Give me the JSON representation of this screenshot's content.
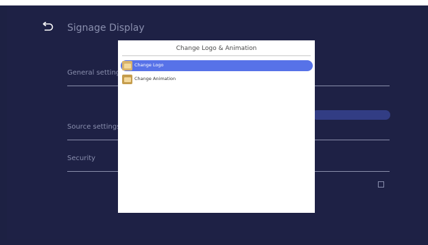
{
  "header": {
    "title": "Signage Display"
  },
  "settings": {
    "general": "General settings",
    "source": "Source settings",
    "security": "Security"
  },
  "dialog": {
    "title": "Change Logo & Animation",
    "items": [
      {
        "label": "Change Logo",
        "selected": true,
        "icon": "folder-icon"
      },
      {
        "label": "Change Animation",
        "selected": false,
        "icon": "folder-icon"
      }
    ]
  },
  "colors": {
    "background": "#1d2143",
    "selection": "#5772e8",
    "pill": "#323d84",
    "folder": "#c59d4d"
  }
}
